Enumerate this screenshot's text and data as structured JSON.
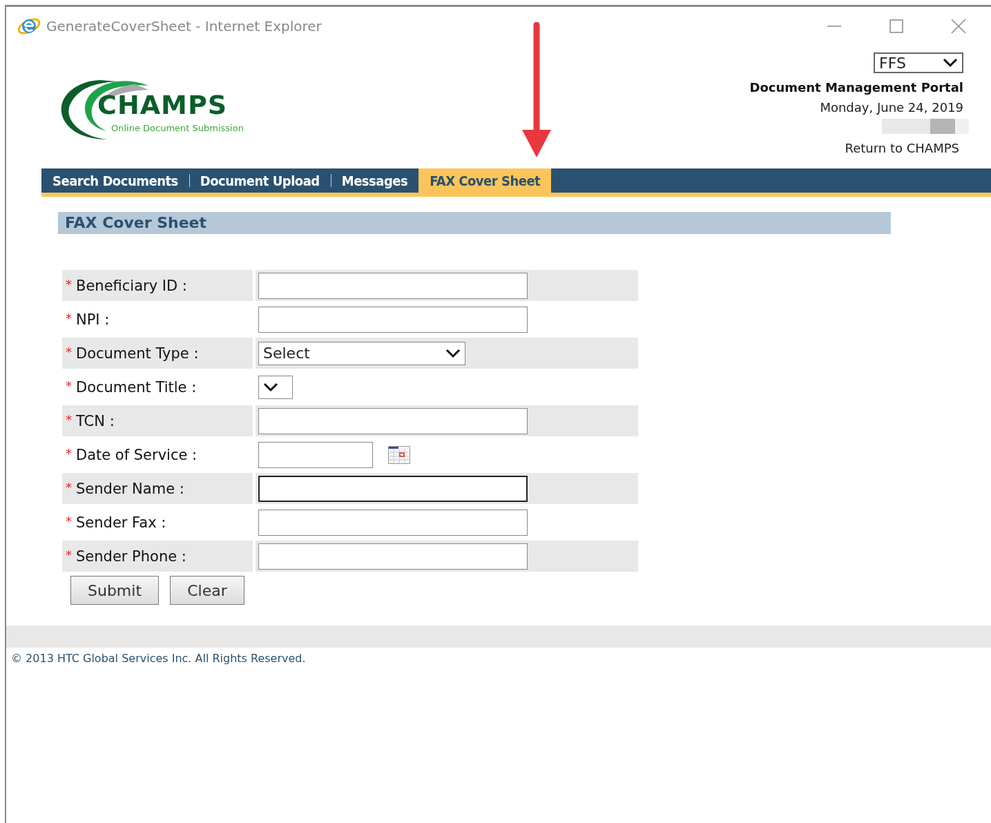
{
  "window": {
    "title": "GenerateCoverSheet - Internet Explorer"
  },
  "header": {
    "logo_title": "CHAMPS",
    "logo_subtitle": "Online Document Submission",
    "program_select": "FFS",
    "portal_title": "Document Management Portal",
    "date": "Monday, June 24, 2019",
    "return_link": "Return to CHAMPS"
  },
  "nav": [
    {
      "label": "Search Documents",
      "selected": false
    },
    {
      "label": "Document Upload",
      "selected": false
    },
    {
      "label": "Messages",
      "selected": false
    },
    {
      "label": "FAX Cover Sheet",
      "selected": true
    }
  ],
  "section_title": "FAX Cover Sheet",
  "form": [
    {
      "mark": "*",
      "label": "Beneficiary ID :",
      "kind": "text",
      "focused": false
    },
    {
      "mark": "*",
      "label": "NPI :",
      "kind": "text",
      "focused": false
    },
    {
      "mark": "*",
      "label": "Document Type :",
      "kind": "select",
      "value": "Select"
    },
    {
      "mark": "*",
      "label": "Document Title :",
      "kind": "select"
    },
    {
      "mark": "*",
      "label": "TCN :",
      "kind": "text",
      "focused": false
    },
    {
      "mark": "*",
      "label": "Date of Service :",
      "kind": "date"
    },
    {
      "mark": "*",
      "label": "Sender Name :",
      "kind": "text",
      "focused": true
    },
    {
      "mark": "*",
      "label": "Sender Fax :",
      "kind": "text",
      "focused": false
    },
    {
      "mark": "*",
      "label": "Sender Phone :",
      "kind": "text",
      "focused": false
    }
  ],
  "buttons": [
    "Submit",
    "Clear"
  ],
  "footer": "© 2013 HTC Global Services Inc. All Rights Reserved."
}
